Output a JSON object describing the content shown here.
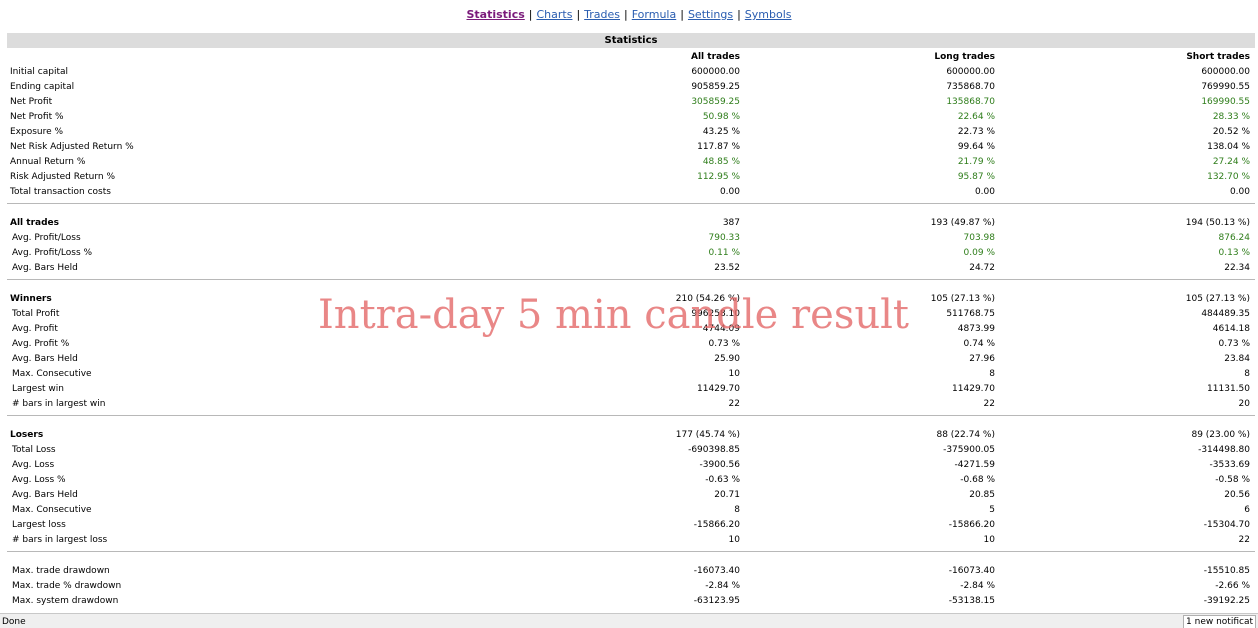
{
  "nav": [
    {
      "label": "Statistics",
      "active": true
    },
    {
      "label": "Charts"
    },
    {
      "label": "Trades"
    },
    {
      "label": "Formula"
    },
    {
      "label": "Settings"
    },
    {
      "label": "Symbols"
    }
  ],
  "title": "Statistics",
  "columns": [
    "All trades",
    "Long trades",
    "Short trades"
  ],
  "sections": [
    {
      "rows": [
        {
          "label": "Initial capital",
          "values": [
            "600000.00",
            "600000.00",
            "600000.00"
          ]
        },
        {
          "label": "Ending capital",
          "values": [
            "905859.25",
            "735868.70",
            "769990.55"
          ]
        },
        {
          "label": "Net Profit",
          "values": [
            "305859.25",
            "135868.70",
            "169990.55"
          ],
          "green": true
        },
        {
          "label": "Net Profit %",
          "values": [
            "50.98 %",
            "22.64 %",
            "28.33 %"
          ],
          "green": true
        },
        {
          "label": "Exposure %",
          "values": [
            "43.25 %",
            "22.73 %",
            "20.52 %"
          ]
        },
        {
          "label": "Net Risk Adjusted Return %",
          "values": [
            "117.87 %",
            "99.64 %",
            "138.04 %"
          ]
        },
        {
          "label": "Annual Return %",
          "values": [
            "48.85 %",
            "21.79 %",
            "27.24 %"
          ],
          "green": true
        },
        {
          "label": "Risk Adjusted Return %",
          "values": [
            "112.95 %",
            "95.87 %",
            "132.70 %"
          ],
          "green": true
        },
        {
          "label": "Total transaction costs",
          "values": [
            "0.00",
            "0.00",
            "0.00"
          ]
        }
      ]
    },
    {
      "rows": [
        {
          "label": "All trades",
          "values": [
            "387",
            "193 (49.87 %)",
            "194 (50.13 %)"
          ],
          "group": true
        },
        {
          "label": "Avg. Profit/Loss",
          "values": [
            "790.33",
            "703.98",
            "876.24"
          ],
          "green": true
        },
        {
          "label": "Avg. Profit/Loss %",
          "values": [
            "0.11 %",
            "0.09 %",
            "0.13 %"
          ],
          "green": true
        },
        {
          "label": "Avg. Bars Held",
          "values": [
            "23.52",
            "24.72",
            "22.34"
          ]
        }
      ]
    },
    {
      "rows": [
        {
          "label": "Winners",
          "values": [
            "210 (54.26 %)",
            "105 (27.13 %)",
            "105 (27.13 %)"
          ],
          "group": true
        },
        {
          "label": "Total Profit",
          "values": [
            "996258.10",
            "511768.75",
            "484489.35"
          ]
        },
        {
          "label": "Avg. Profit",
          "values": [
            "4744.09",
            "4873.99",
            "4614.18"
          ]
        },
        {
          "label": "Avg. Profit %",
          "values": [
            "0.73 %",
            "0.74 %",
            "0.73 %"
          ]
        },
        {
          "label": "Avg. Bars Held",
          "values": [
            "25.90",
            "27.96",
            "23.84"
          ]
        },
        {
          "label": "Max. Consecutive",
          "values": [
            "10",
            "8",
            "8"
          ]
        },
        {
          "label": "Largest win",
          "values": [
            "11429.70",
            "11429.70",
            "11131.50"
          ]
        },
        {
          "label": "# bars in largest win",
          "values": [
            "22",
            "22",
            "20"
          ]
        }
      ]
    },
    {
      "rows": [
        {
          "label": "Losers",
          "values": [
            "177 (45.74 %)",
            "88 (22.74 %)",
            "89 (23.00 %)"
          ],
          "group": true
        },
        {
          "label": "Total Loss",
          "values": [
            "-690398.85",
            "-375900.05",
            "-314498.80"
          ]
        },
        {
          "label": "Avg. Loss",
          "values": [
            "-3900.56",
            "-4271.59",
            "-3533.69"
          ]
        },
        {
          "label": "Avg. Loss %",
          "values": [
            "-0.63 %",
            "-0.68 %",
            "-0.58 %"
          ]
        },
        {
          "label": "Avg. Bars Held",
          "values": [
            "20.71",
            "20.85",
            "20.56"
          ]
        },
        {
          "label": "Max. Consecutive",
          "values": [
            "8",
            "5",
            "6"
          ]
        },
        {
          "label": "Largest loss",
          "values": [
            "-15866.20",
            "-15866.20",
            "-15304.70"
          ]
        },
        {
          "label": "# bars in largest loss",
          "values": [
            "10",
            "10",
            "22"
          ]
        }
      ]
    },
    {
      "rows": [
        {
          "label": "Max. trade drawdown",
          "values": [
            "-16073.40",
            "-16073.40",
            "-15510.85"
          ]
        },
        {
          "label": "Max. trade % drawdown",
          "values": [
            "-2.84 %",
            "-2.84 %",
            "-2.66 %"
          ]
        },
        {
          "label": "Max. system drawdown",
          "values": [
            "-63123.95",
            "-53138.15",
            "-39192.25"
          ]
        }
      ]
    }
  ],
  "watermark": "Intra-day 5 min candle result",
  "status": {
    "text": "Done",
    "notification": "1 new notificat"
  },
  "colors": {
    "positive": "#2e7d1a",
    "link": "#2a5db0",
    "active_link": "#7a1a7a",
    "watermark": "#e46a6a",
    "header_bg": "#dcdcdc"
  }
}
